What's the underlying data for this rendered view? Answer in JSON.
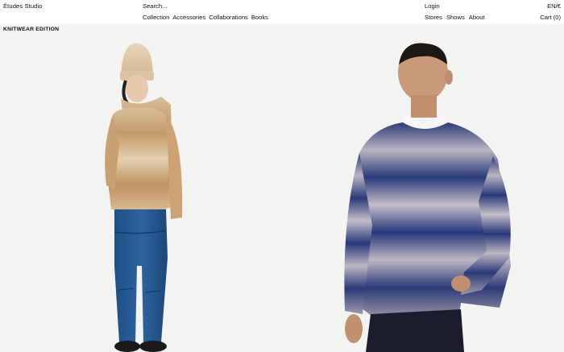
{
  "header": {
    "brand": "Études Studio",
    "search_placeholder": "Search...",
    "login": "Login",
    "language_currency": "EN/€",
    "cart": "Cart (0)"
  },
  "nav_left": {
    "items": [
      "Collection",
      "Accessories",
      "Collaborations",
      "Books"
    ]
  },
  "nav_right": {
    "items": [
      "Stores",
      "Shows",
      "About"
    ]
  },
  "section": {
    "title": "KNITWEAR EDITION"
  },
  "colors": {
    "background": "#f4f4f2",
    "header_bg": "#ffffff",
    "text": "#111111"
  }
}
